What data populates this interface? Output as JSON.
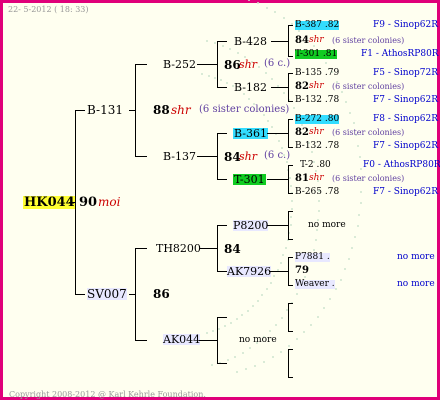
{
  "header": {
    "date": "22- 5-2012 ( 18: 33)"
  },
  "footer": {
    "copyright": "Copyright 2008-2012 @ Karl Kehrle Foundation."
  },
  "root": {
    "id": "HK044",
    "gen": "90",
    "breed": "moi"
  },
  "g1": [
    {
      "id": "B-131",
      "gen": "88",
      "breed": "shr",
      "siblings": "(6 sister colonies)"
    },
    {
      "id": "SV007",
      "gen": "86"
    }
  ],
  "g2": [
    {
      "id": "B-252",
      "gen": "86",
      "breed": "shr",
      "siblings": "(6 c.)"
    },
    {
      "id": "B-137",
      "gen": "84",
      "breed": "shr",
      "siblings": "(6 c.)"
    },
    {
      "id": "TH8200",
      "gen": "84"
    },
    {
      "id": "AK044",
      "note": "no more"
    }
  ],
  "g3": [
    "B-428",
    "B-182",
    "B-361",
    "T-301",
    "P8200",
    "AK7926"
  ],
  "g4": [
    {
      "top": "B-387 .82",
      "mid_gen": "84",
      "mid_breed": "shr",
      "mid_sib": "(6 sister colonies)",
      "bot": "T-301 .81",
      "right": [
        "F9 - Sinop62R",
        "",
        "F1 - AthosRP80R"
      ]
    },
    {
      "top": "B-135 .79",
      "mid_gen": "82",
      "mid_breed": "shr",
      "mid_sib": "(6 sister colonies)",
      "bot": "B-132 .78",
      "right": [
        "F5 - Sinop72R",
        "",
        "F7 - Sinop62R"
      ]
    },
    {
      "top": "B-272 .80",
      "mid_gen": "82",
      "mid_breed": "shr",
      "mid_sib": "(6 sister colonies)",
      "bot": "B-132 .78",
      "right": [
        "F8 - Sinop62R",
        "",
        "F7 - Sinop62R"
      ]
    },
    {
      "top": "T-2 .80",
      "mid_gen": "81",
      "mid_breed": "shr",
      "mid_sib": "(6 sister colonies)",
      "bot": "B-265 .78",
      "right": [
        "F0 - AthosRP80R",
        "",
        "F7 - Sinop62R"
      ]
    },
    {
      "note": "no more"
    },
    {
      "top": "P7881 .",
      "mid_gen": "79",
      "bot": "Weaver .",
      "right": [
        "no more",
        "",
        "no more"
      ]
    }
  ]
}
